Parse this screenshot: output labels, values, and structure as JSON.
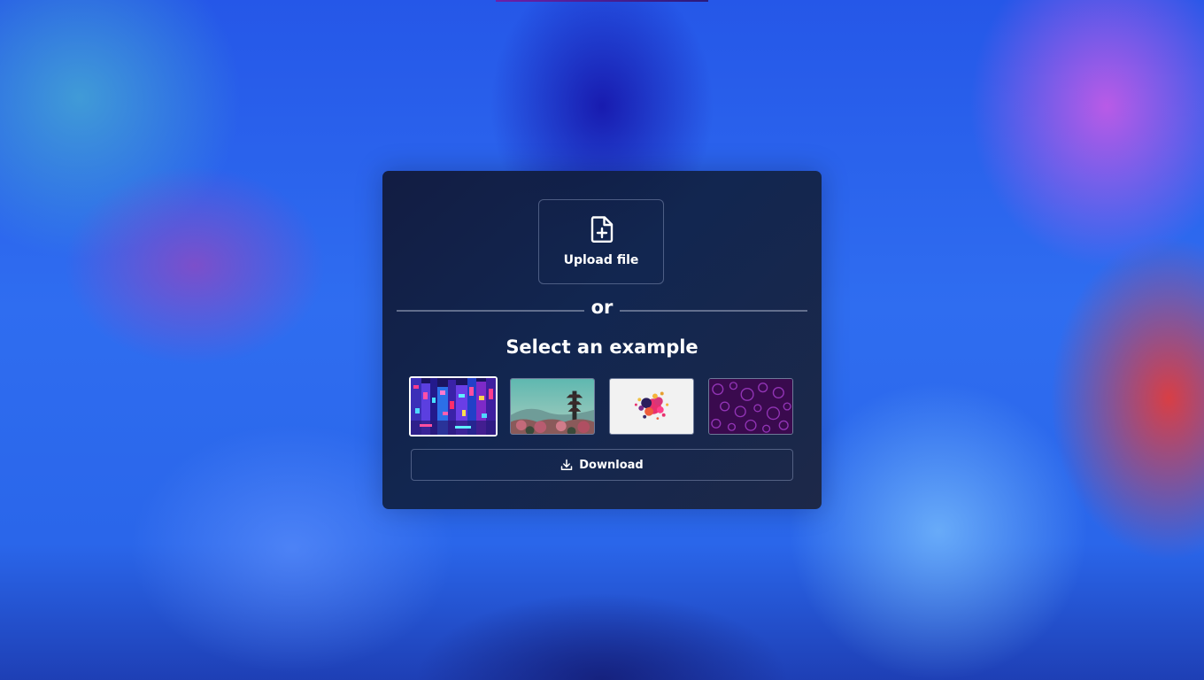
{
  "upload": {
    "label": "Upload file",
    "icon": "file-plus-icon"
  },
  "separator": {
    "text": "or"
  },
  "examples": {
    "title": "Select an example",
    "selected_index": 0,
    "items": [
      {
        "name": "neon-city-street"
      },
      {
        "name": "pagoda-landscape"
      },
      {
        "name": "paint-splash"
      },
      {
        "name": "purple-bubbles"
      }
    ]
  },
  "download": {
    "label": "Download",
    "icon": "download-icon"
  },
  "colors": {
    "text": "#ffffff",
    "panel": "#141e3c",
    "border": "#96a5c8"
  }
}
